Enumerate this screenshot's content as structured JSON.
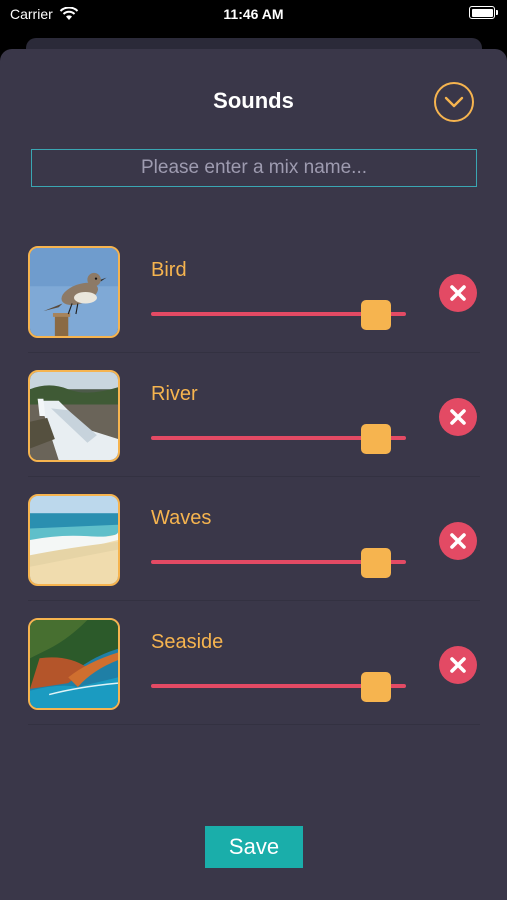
{
  "status_bar": {
    "carrier": "Carrier",
    "time": "11:46 AM"
  },
  "sheet": {
    "title": "Sounds",
    "collapse_icon": "chevron-down-circle-icon",
    "mix_name": {
      "value": "",
      "placeholder": "Please enter a mix name..."
    },
    "sounds": [
      {
        "label": "Bird",
        "image": "bird-photo",
        "volume": 0.94
      },
      {
        "label": "River",
        "image": "river-photo",
        "volume": 0.94
      },
      {
        "label": "Waves",
        "image": "waves-photo",
        "volume": 0.94
      },
      {
        "label": "Seaside",
        "image": "seaside-photo",
        "volume": 0.94
      }
    ],
    "remove_icon": "close-circle-icon",
    "save_label": "Save"
  },
  "colors": {
    "sheet_bg": "#3a3749",
    "accent_orange": "#f6b44f",
    "slider_red": "#e34a64",
    "input_border": "#3aa6b3",
    "save_teal": "#1aaeaa"
  }
}
